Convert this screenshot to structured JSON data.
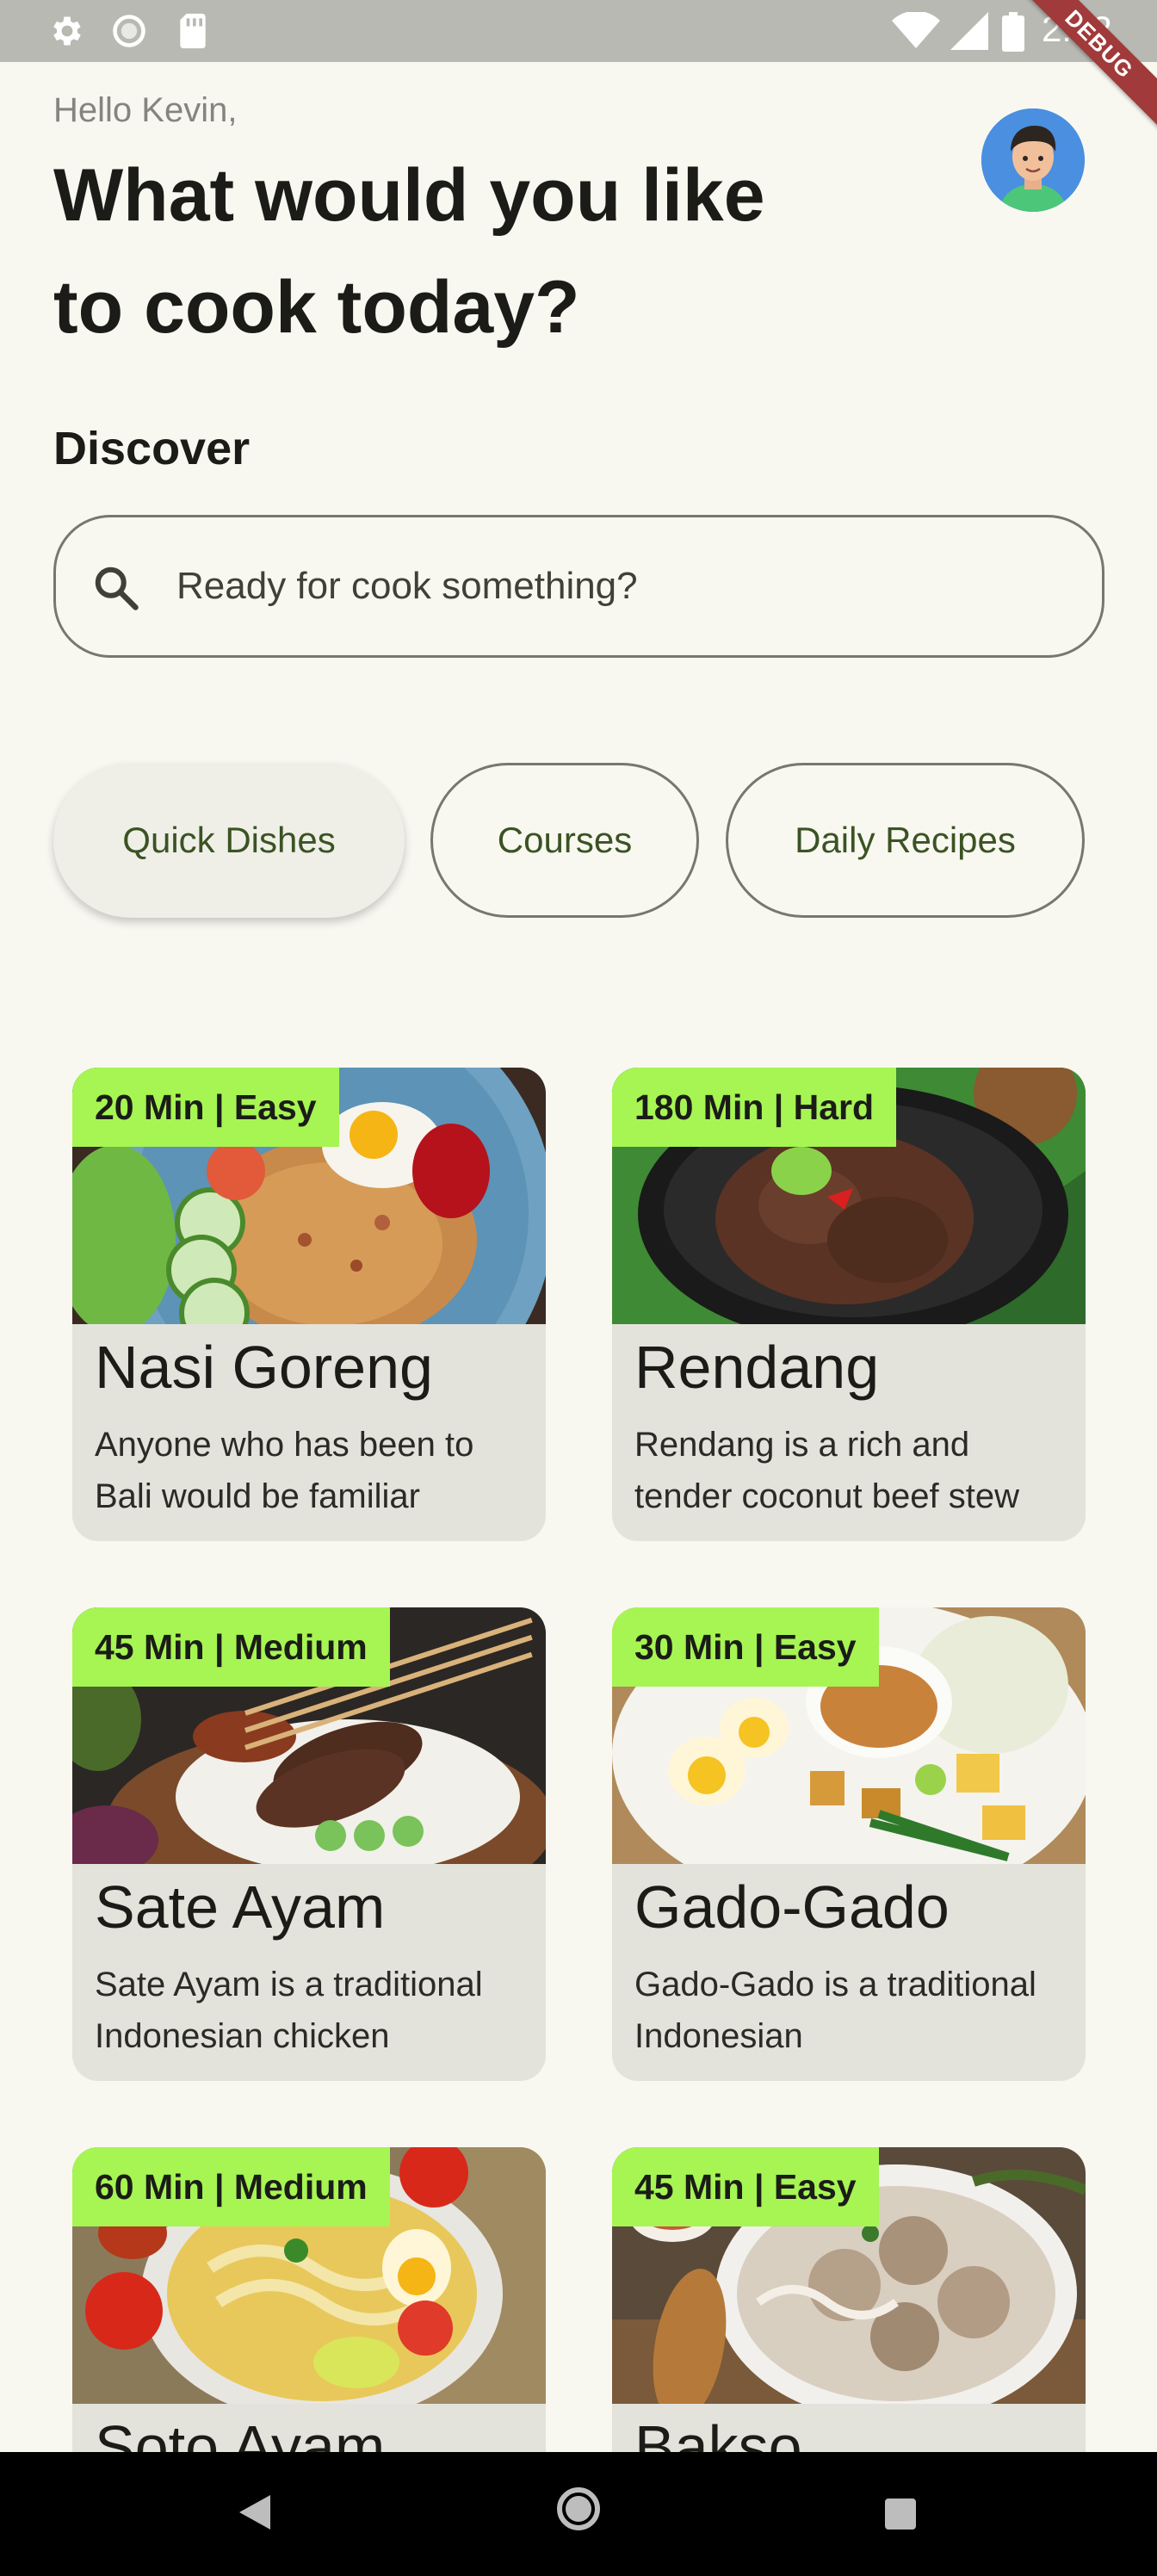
{
  "status_bar": {
    "time": "2:12",
    "debug_label": "DEBUG",
    "icons": [
      "gear-icon",
      "circle-icon",
      "sd-card-icon",
      "wifi-icon",
      "signal-icon",
      "battery-icon"
    ]
  },
  "header": {
    "greeting": "Hello Kevin,",
    "headline": "What would you like to cook today?",
    "avatar_icon": "avatar-icon"
  },
  "discover": {
    "title": "Discover",
    "search_placeholder": "Ready for cook something?",
    "search_icon": "search-icon"
  },
  "categories": [
    {
      "label": "Quick Dishes",
      "selected": true
    },
    {
      "label": "Courses",
      "selected": false
    },
    {
      "label": "Daily Recipes",
      "selected": false
    }
  ],
  "recipes": [
    {
      "badge": "20 Min | Easy",
      "title": "Nasi Goreng",
      "description": "Anyone who has been to Bali would be familiar"
    },
    {
      "badge": "180 Min | Hard",
      "title": "Rendang",
      "description": "Rendang is a rich and tender coconut beef stew"
    },
    {
      "badge": "45 Min | Medium",
      "title": "Sate Ayam",
      "description": "Sate Ayam is a traditional Indonesian chicken"
    },
    {
      "badge": "30 Min | Easy",
      "title": "Gado-Gado",
      "description": "Gado-Gado is a traditional Indonesian"
    },
    {
      "badge": "60 Min | Medium",
      "title": "Soto Ayam",
      "description": ""
    },
    {
      "badge": "45 Min | Easy",
      "title": "Bakso",
      "description": ""
    }
  ],
  "colors": {
    "background": "#f8f8f1",
    "badge": "#a6f553",
    "card": "#e3e3dc",
    "chip_text": "#3b5323",
    "outline": "#76786b"
  },
  "nav": {
    "icons": [
      "back-icon",
      "home-icon",
      "recents-icon"
    ]
  }
}
